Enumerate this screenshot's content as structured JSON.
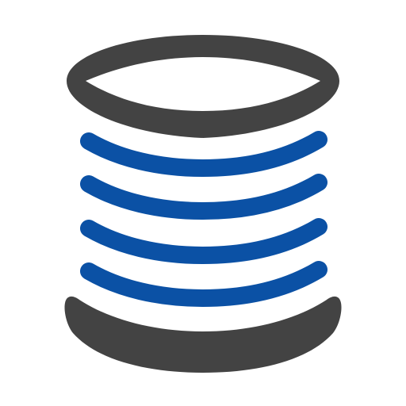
{
  "icon": {
    "name": "database-stack-icon",
    "colors": {
      "outline": "#434343",
      "stripes": "#0b51a5",
      "background": "#ffffff"
    }
  }
}
